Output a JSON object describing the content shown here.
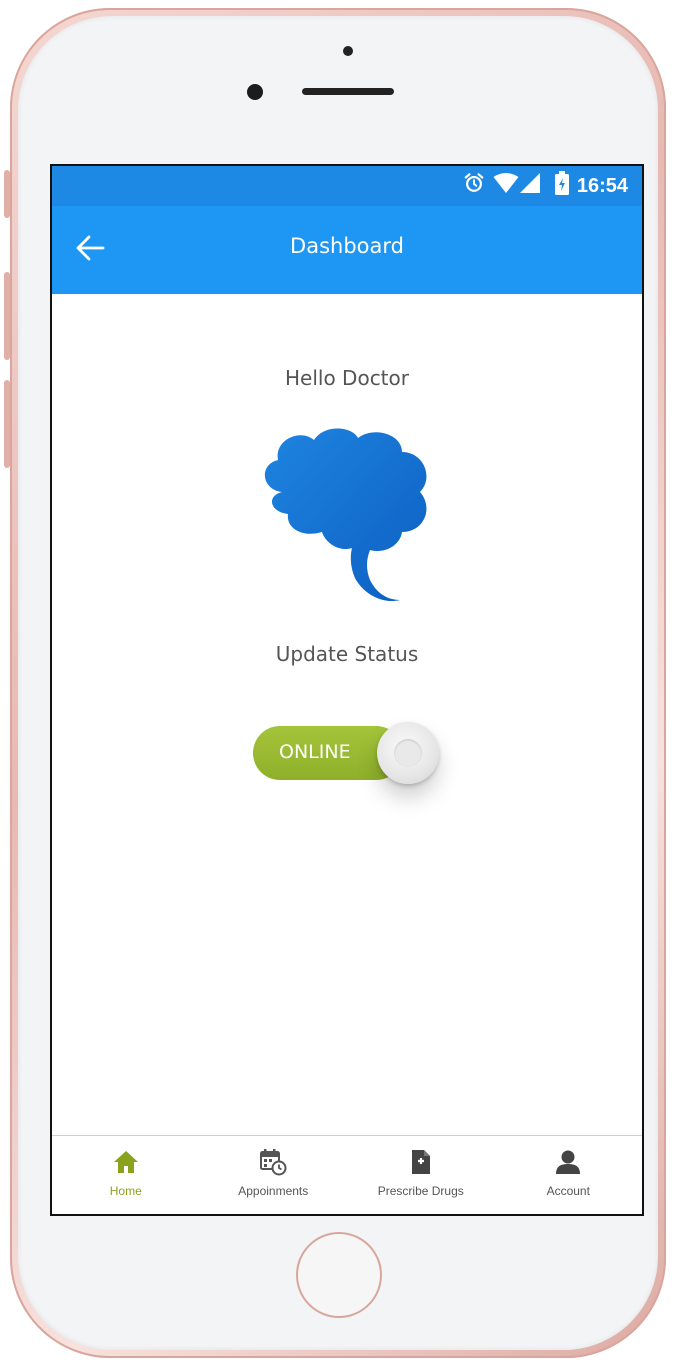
{
  "status_bar": {
    "time": "16:54",
    "icons": [
      "alarm-icon",
      "wifi-icon",
      "signal-icon",
      "battery-icon"
    ]
  },
  "app_bar": {
    "title": "Dashboard",
    "back_icon": "arrow-left-icon",
    "color": "#1e96f3"
  },
  "content": {
    "greeting": "Hello Doctor",
    "brain_icon": "brain-icon",
    "update_status_label": "Update Status",
    "status_toggle": {
      "label": "ONLINE",
      "state": "on",
      "on_color": "#9bbd31"
    }
  },
  "bottom_nav": {
    "items": [
      {
        "label": "Home",
        "icon": "home-icon",
        "active": true
      },
      {
        "label": "Appoinments",
        "icon": "calendar-clock-icon",
        "active": false
      },
      {
        "label": "Prescribe Drugs",
        "icon": "prescription-file-icon",
        "active": false
      },
      {
        "label": "Account",
        "icon": "user-icon",
        "active": false
      }
    ],
    "active_color": "#8aa31f"
  }
}
